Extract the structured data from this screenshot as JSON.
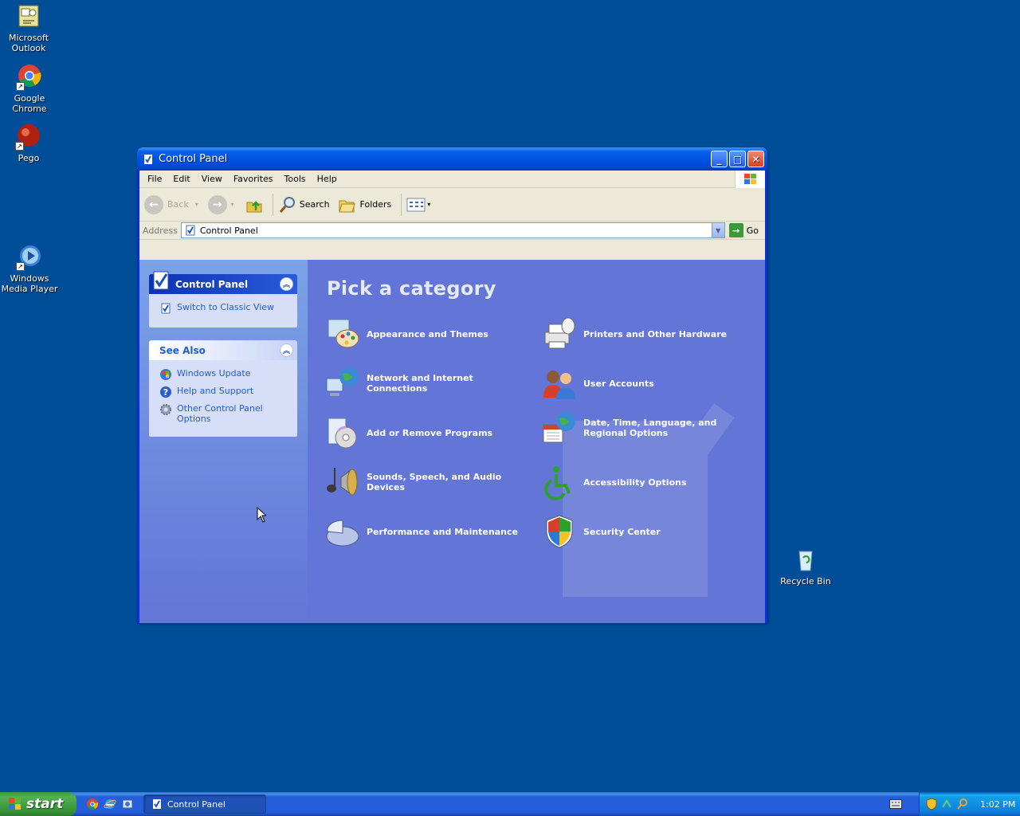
{
  "desktop": {
    "icons": [
      {
        "label": "Microsoft Outlook"
      },
      {
        "label": "Google Chrome"
      },
      {
        "label": "Pego"
      },
      {
        "label": "Windows Media Player"
      },
      {
        "label": "Recycle Bin"
      }
    ]
  },
  "window": {
    "title": "Control Panel",
    "menu": [
      "File",
      "Edit",
      "View",
      "Favorites",
      "Tools",
      "Help"
    ],
    "toolbar": {
      "back": "Back",
      "search": "Search",
      "folders": "Folders"
    },
    "address": {
      "label": "Address",
      "value": "Control Panel",
      "go": "Go"
    },
    "taskpane": {
      "control_panel": {
        "header": "Control Panel",
        "link": "Switch to Classic View"
      },
      "see_also": {
        "header": "See Also",
        "links": [
          "Windows Update",
          "Help and Support",
          "Other Control Panel Options"
        ]
      }
    },
    "main": {
      "title": "Pick a category",
      "categories": [
        "Appearance and Themes",
        "Printers and Other Hardware",
        "Network and Internet Connections",
        "User Accounts",
        "Add or Remove Programs",
        "Date, Time, Language, and Regional Options",
        "Sounds, Speech, and Audio Devices",
        "Accessibility Options",
        "Performance and Maintenance",
        "Security Center"
      ]
    }
  },
  "taskbar": {
    "start": "start",
    "task": "Control Panel",
    "clock": "1:02 PM"
  },
  "colors": {
    "desktop": "#004e98",
    "taskpane_link": "#215dc6",
    "category_bg": "#6375d6"
  }
}
